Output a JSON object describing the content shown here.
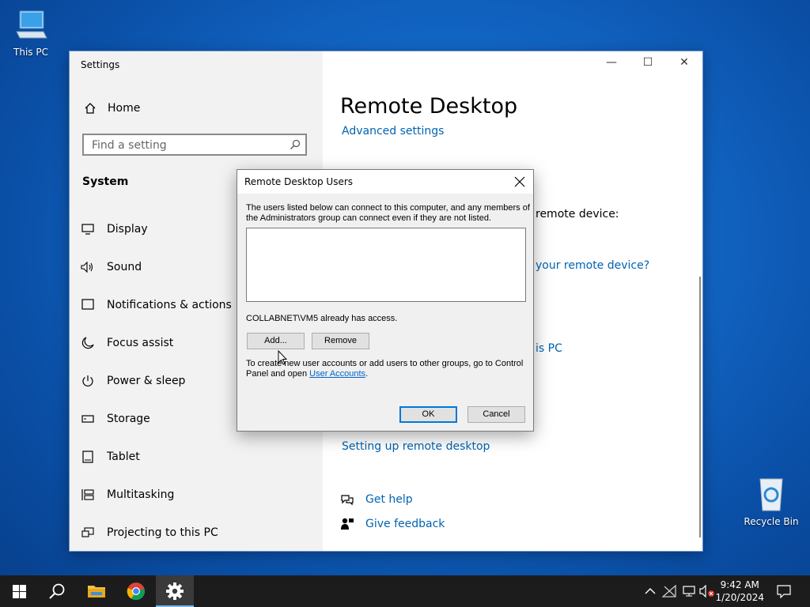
{
  "desktop": {
    "this_pc": "This PC",
    "recycle_bin": "Recycle Bin"
  },
  "settings": {
    "window_title": "Settings",
    "home_label": "Home",
    "search_placeholder": "Find a setting",
    "section_title": "System",
    "nav_items": [
      {
        "label": "Display",
        "icon": "display-icon"
      },
      {
        "label": "Sound",
        "icon": "speaker-icon"
      },
      {
        "label": "Notifications & actions",
        "icon": "notifications-icon"
      },
      {
        "label": "Focus assist",
        "icon": "moon-icon"
      },
      {
        "label": "Power & sleep",
        "icon": "power-icon"
      },
      {
        "label": "Storage",
        "icon": "storage-icon"
      },
      {
        "label": "Tablet",
        "icon": "tablet-icon"
      },
      {
        "label": "Multitasking",
        "icon": "multitasking-icon"
      },
      {
        "label": "Projecting to this PC",
        "icon": "projecting-icon"
      }
    ],
    "window_controls": {
      "minimize": "—",
      "maximize": "☐",
      "close": "✕"
    },
    "page_title": "Remote Desktop",
    "advanced_settings": "Advanced settings",
    "partial_remote_device": "remote device:",
    "partial_remote_device_q": "your remote device?",
    "partial_this_pc": "is PC",
    "setting_up": "Setting up remote desktop",
    "get_help": "Get help",
    "give_feedback": "Give feedback"
  },
  "dialog": {
    "title": "Remote Desktop Users",
    "description_line1": "The users listed below can connect to this computer, and any members of",
    "description_line2": "the Administrators group can connect even if they are not listed.",
    "access_text": "COLLABNET\\VM5 already has access.",
    "add_button": "Add...",
    "remove_button": "Remove",
    "info_line1": "To create new user accounts or add users to other groups, go to Control",
    "info_line2_prefix": "Panel and open ",
    "info_link": "User Accounts",
    "info_line2_suffix": ".",
    "ok_button": "OK",
    "cancel_button": "Cancel"
  },
  "taskbar": {
    "time": "9:42 AM",
    "date": "1/20/2024"
  },
  "colors": {
    "accent": "#0078d7",
    "link": "#0063b1"
  }
}
